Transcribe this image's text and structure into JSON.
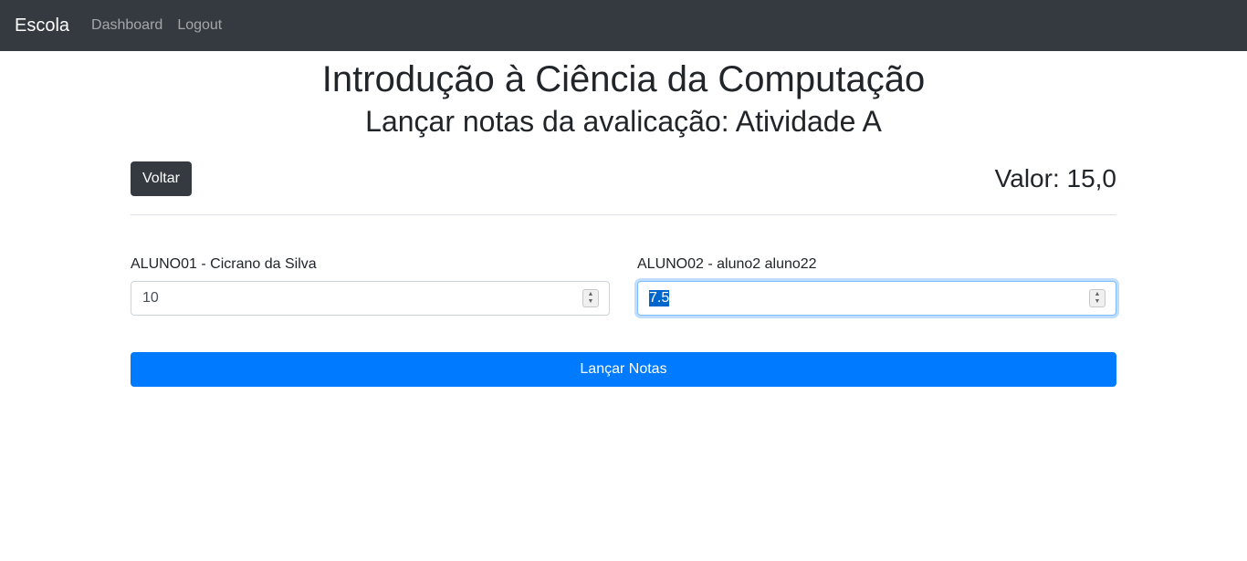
{
  "navbar": {
    "brand": "Escola",
    "links": [
      "Dashboard",
      "Logout"
    ]
  },
  "header": {
    "title": "Introdução à Ciência da Computação",
    "subtitle": "Lançar notas da avalicação: Atividade A"
  },
  "toolbar": {
    "back_label": "Voltar",
    "valor": "Valor: 15,0"
  },
  "students": [
    {
      "label": "ALUNO01 - Cicrano da Silva",
      "value": "10"
    },
    {
      "label": "ALUNO02 - aluno2 aluno22",
      "value": "7.5"
    }
  ],
  "submit_label": "Lançar Notas",
  "colors": {
    "navbar": "#343a40",
    "primary": "#007bff",
    "dark_button": "#343a40"
  }
}
